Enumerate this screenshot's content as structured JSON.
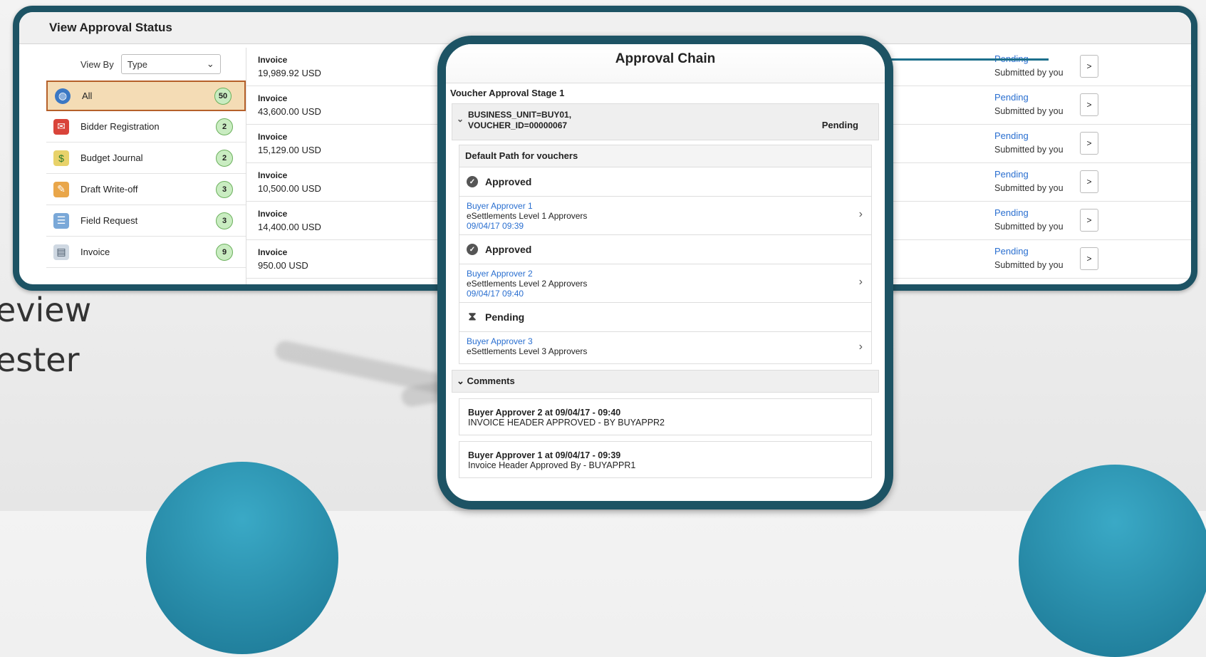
{
  "background": {
    "text_lines": [
      "eview",
      "ester"
    ]
  },
  "main": {
    "title": "View Approval Status",
    "view_by_label": "View By",
    "view_by_value": "Type",
    "categories": [
      {
        "label": "All",
        "count": "50",
        "icon": "globe-icon",
        "selected": true
      },
      {
        "label": "Bidder Registration",
        "count": "2",
        "icon": "bidder-registration-icon"
      },
      {
        "label": "Budget Journal",
        "count": "2",
        "icon": "budget-journal-icon"
      },
      {
        "label": "Draft Write-off",
        "count": "3",
        "icon": "draft-write-off-icon"
      },
      {
        "label": "Field Request",
        "count": "3",
        "icon": "field-request-icon"
      },
      {
        "label": "Invoice",
        "count": "9",
        "icon": "invoice-icon"
      }
    ],
    "rows": [
      {
        "type": "Invoice",
        "amount": "19,989.92  USD",
        "status": "Pending",
        "submitted": "Submitted by you",
        "button": ">"
      },
      {
        "type": "Invoice",
        "amount": "43,600.00  USD",
        "status": "Pending",
        "submitted": "Submitted by you",
        "button": ">"
      },
      {
        "type": "Invoice",
        "amount": "15,129.00  USD",
        "status": "Pending",
        "submitted": "Submitted by you",
        "button": ">"
      },
      {
        "type": "Invoice",
        "amount": "10,500.00  USD",
        "status": "Pending",
        "submitted": "Submitted by you",
        "button": ">"
      },
      {
        "type": "Invoice",
        "amount": "14,400.00  USD",
        "status": "Pending",
        "submitted": "Submitted by you",
        "button": ">"
      },
      {
        "type": "Invoice",
        "amount": "950.00  USD",
        "status": "Pending",
        "submitted": "Submitted by you",
        "button": ">"
      }
    ]
  },
  "approval_chain": {
    "title": "Approval Chain",
    "stage": "Voucher Approval Stage 1",
    "unit_line1": "BUSINESS_UNIT=BUY01,",
    "unit_line2": "VOUCHER_ID=00000067",
    "unit_status": "Pending",
    "path_title": "Default Path for vouchers",
    "steps": [
      {
        "status": "Approved",
        "name": "Buyer Approver 1",
        "role": "eSettlements Level 1 Approvers",
        "date": "09/04/17 09:39"
      },
      {
        "status": "Approved",
        "name": "Buyer Approver 2",
        "role": "eSettlements Level 2 Approvers",
        "date": "09/04/17 09:40"
      },
      {
        "status": "Pending",
        "name": "Buyer Approver 3",
        "role": "eSettlements Level 3 Approvers",
        "date": ""
      }
    ],
    "comments_label": "Comments",
    "comments": [
      {
        "header": "Buyer Approver 2 at 09/04/17 - 09:40",
        "text": "INVOICE HEADER APPROVED - BY BUYAPPR2"
      },
      {
        "header": "Buyer Approver 1 at 09/04/17 - 09:39",
        "text": "Invoice Header Approved By - BUYAPPR1"
      }
    ]
  },
  "colors": {
    "frame": "#1d5364",
    "link": "#2a6fd0",
    "selected_bg": "#f4dcb5",
    "badge_bg": "#c9ecc1"
  }
}
